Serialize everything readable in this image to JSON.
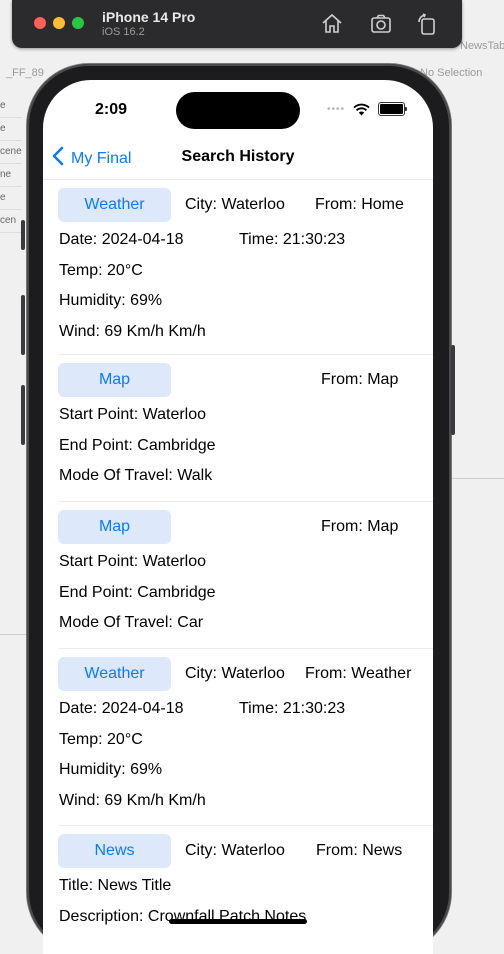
{
  "simulator": {
    "device": "iPhone 14 Pro",
    "os": "iOS 16.2",
    "icons": [
      "home-icon",
      "screenshot-icon",
      "rotate-icon"
    ]
  },
  "background": {
    "fragments": [
      "NewsTab",
      "No Selection",
      "_FF_89"
    ],
    "left_items": [
      "e",
      "e",
      "cene",
      "ne",
      "e",
      "cen"
    ]
  },
  "status_bar": {
    "time": "2:09"
  },
  "nav": {
    "back_label": "My Final",
    "title": "Search History"
  },
  "entries": [
    {
      "type_label": "Weather",
      "city": "City: Waterloo",
      "from": "From: Home",
      "rows": [
        [
          "Date: 2024-04-18",
          "Time: 21:30:23"
        ],
        [
          "Temp: 20°C"
        ],
        [
          "Humidity: 69%"
        ],
        [
          "Wind: 69 Km/h Km/h"
        ]
      ]
    },
    {
      "type_label": "Map",
      "city": "",
      "from": "From: Map",
      "rows": [
        [
          "Start Point: Waterloo"
        ],
        [
          "End Point: Cambridge"
        ],
        [
          "Mode Of Travel: Walk"
        ]
      ]
    },
    {
      "type_label": "Map",
      "city": "",
      "from": "From: Map",
      "rows": [
        [
          "Start Point: Waterloo"
        ],
        [
          "End Point: Cambridge"
        ],
        [
          "Mode Of Travel: Car"
        ]
      ]
    },
    {
      "type_label": "Weather",
      "city": "City: Waterloo",
      "from": "From: Weather",
      "rows": [
        [
          "Date: 2024-04-18",
          "Time: 21:30:23"
        ],
        [
          "Temp: 20°C"
        ],
        [
          "Humidity: 69%"
        ],
        [
          "Wind: 69 Km/h Km/h"
        ]
      ]
    },
    {
      "type_label": "News",
      "city": "City: Waterloo",
      "from": "From: News",
      "rows": [
        [
          "Title: News Title"
        ],
        [
          "Description: Crownfall Patch Notes"
        ]
      ]
    }
  ],
  "colors": {
    "accent": "#0a7aff",
    "pill_bg": "#dde9fb"
  }
}
